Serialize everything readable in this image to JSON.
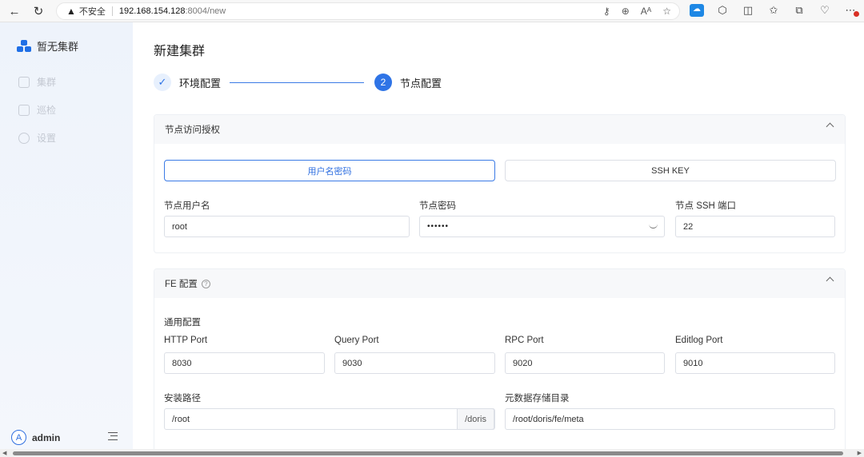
{
  "browser": {
    "security_label": "不安全",
    "url_host": "192.168.154.128",
    "url_rest": ":8004/new"
  },
  "sidebar": {
    "brand_name": "暂无集群",
    "items": [
      {
        "label": "集群",
        "icon": "cluster-icon"
      },
      {
        "label": "巡检",
        "icon": "shield-icon"
      },
      {
        "label": "设置",
        "icon": "gear-icon"
      }
    ],
    "user": {
      "avatar_letter": "A",
      "name": "admin"
    }
  },
  "page": {
    "title": "新建集群",
    "steps": [
      {
        "label": "环境配置",
        "status": "done"
      },
      {
        "number": "2",
        "label": "节点配置",
        "status": "active"
      }
    ]
  },
  "node_access": {
    "title": "节点访问授权",
    "auth_options": [
      "用户名密码",
      "SSH KEY"
    ],
    "selected_auth": "用户名密码",
    "fields": {
      "user_label": "节点用户名",
      "user_value": "root",
      "password_label": "节点密码",
      "password_value": "••••••",
      "ssh_port_label": "节点 SSH 端口",
      "ssh_port_value": "22"
    }
  },
  "fe_config": {
    "title": "FE 配置",
    "section_label": "通用配置",
    "ports": [
      {
        "label": "HTTP Port",
        "value": "8030"
      },
      {
        "label": "Query Port",
        "value": "9030"
      },
      {
        "label": "RPC Port",
        "value": "9020"
      },
      {
        "label": "Editlog Port",
        "value": "9010"
      }
    ],
    "install_path_label": "安装路径",
    "install_path_value": "/root",
    "install_path_suffix": "/doris",
    "meta_dir_label": "元数据存储目录",
    "meta_dir_value": "/root/doris/fe/meta"
  },
  "colors": {
    "accent": "#2f74e6",
    "sidebar_bg": "#eef3fb"
  }
}
